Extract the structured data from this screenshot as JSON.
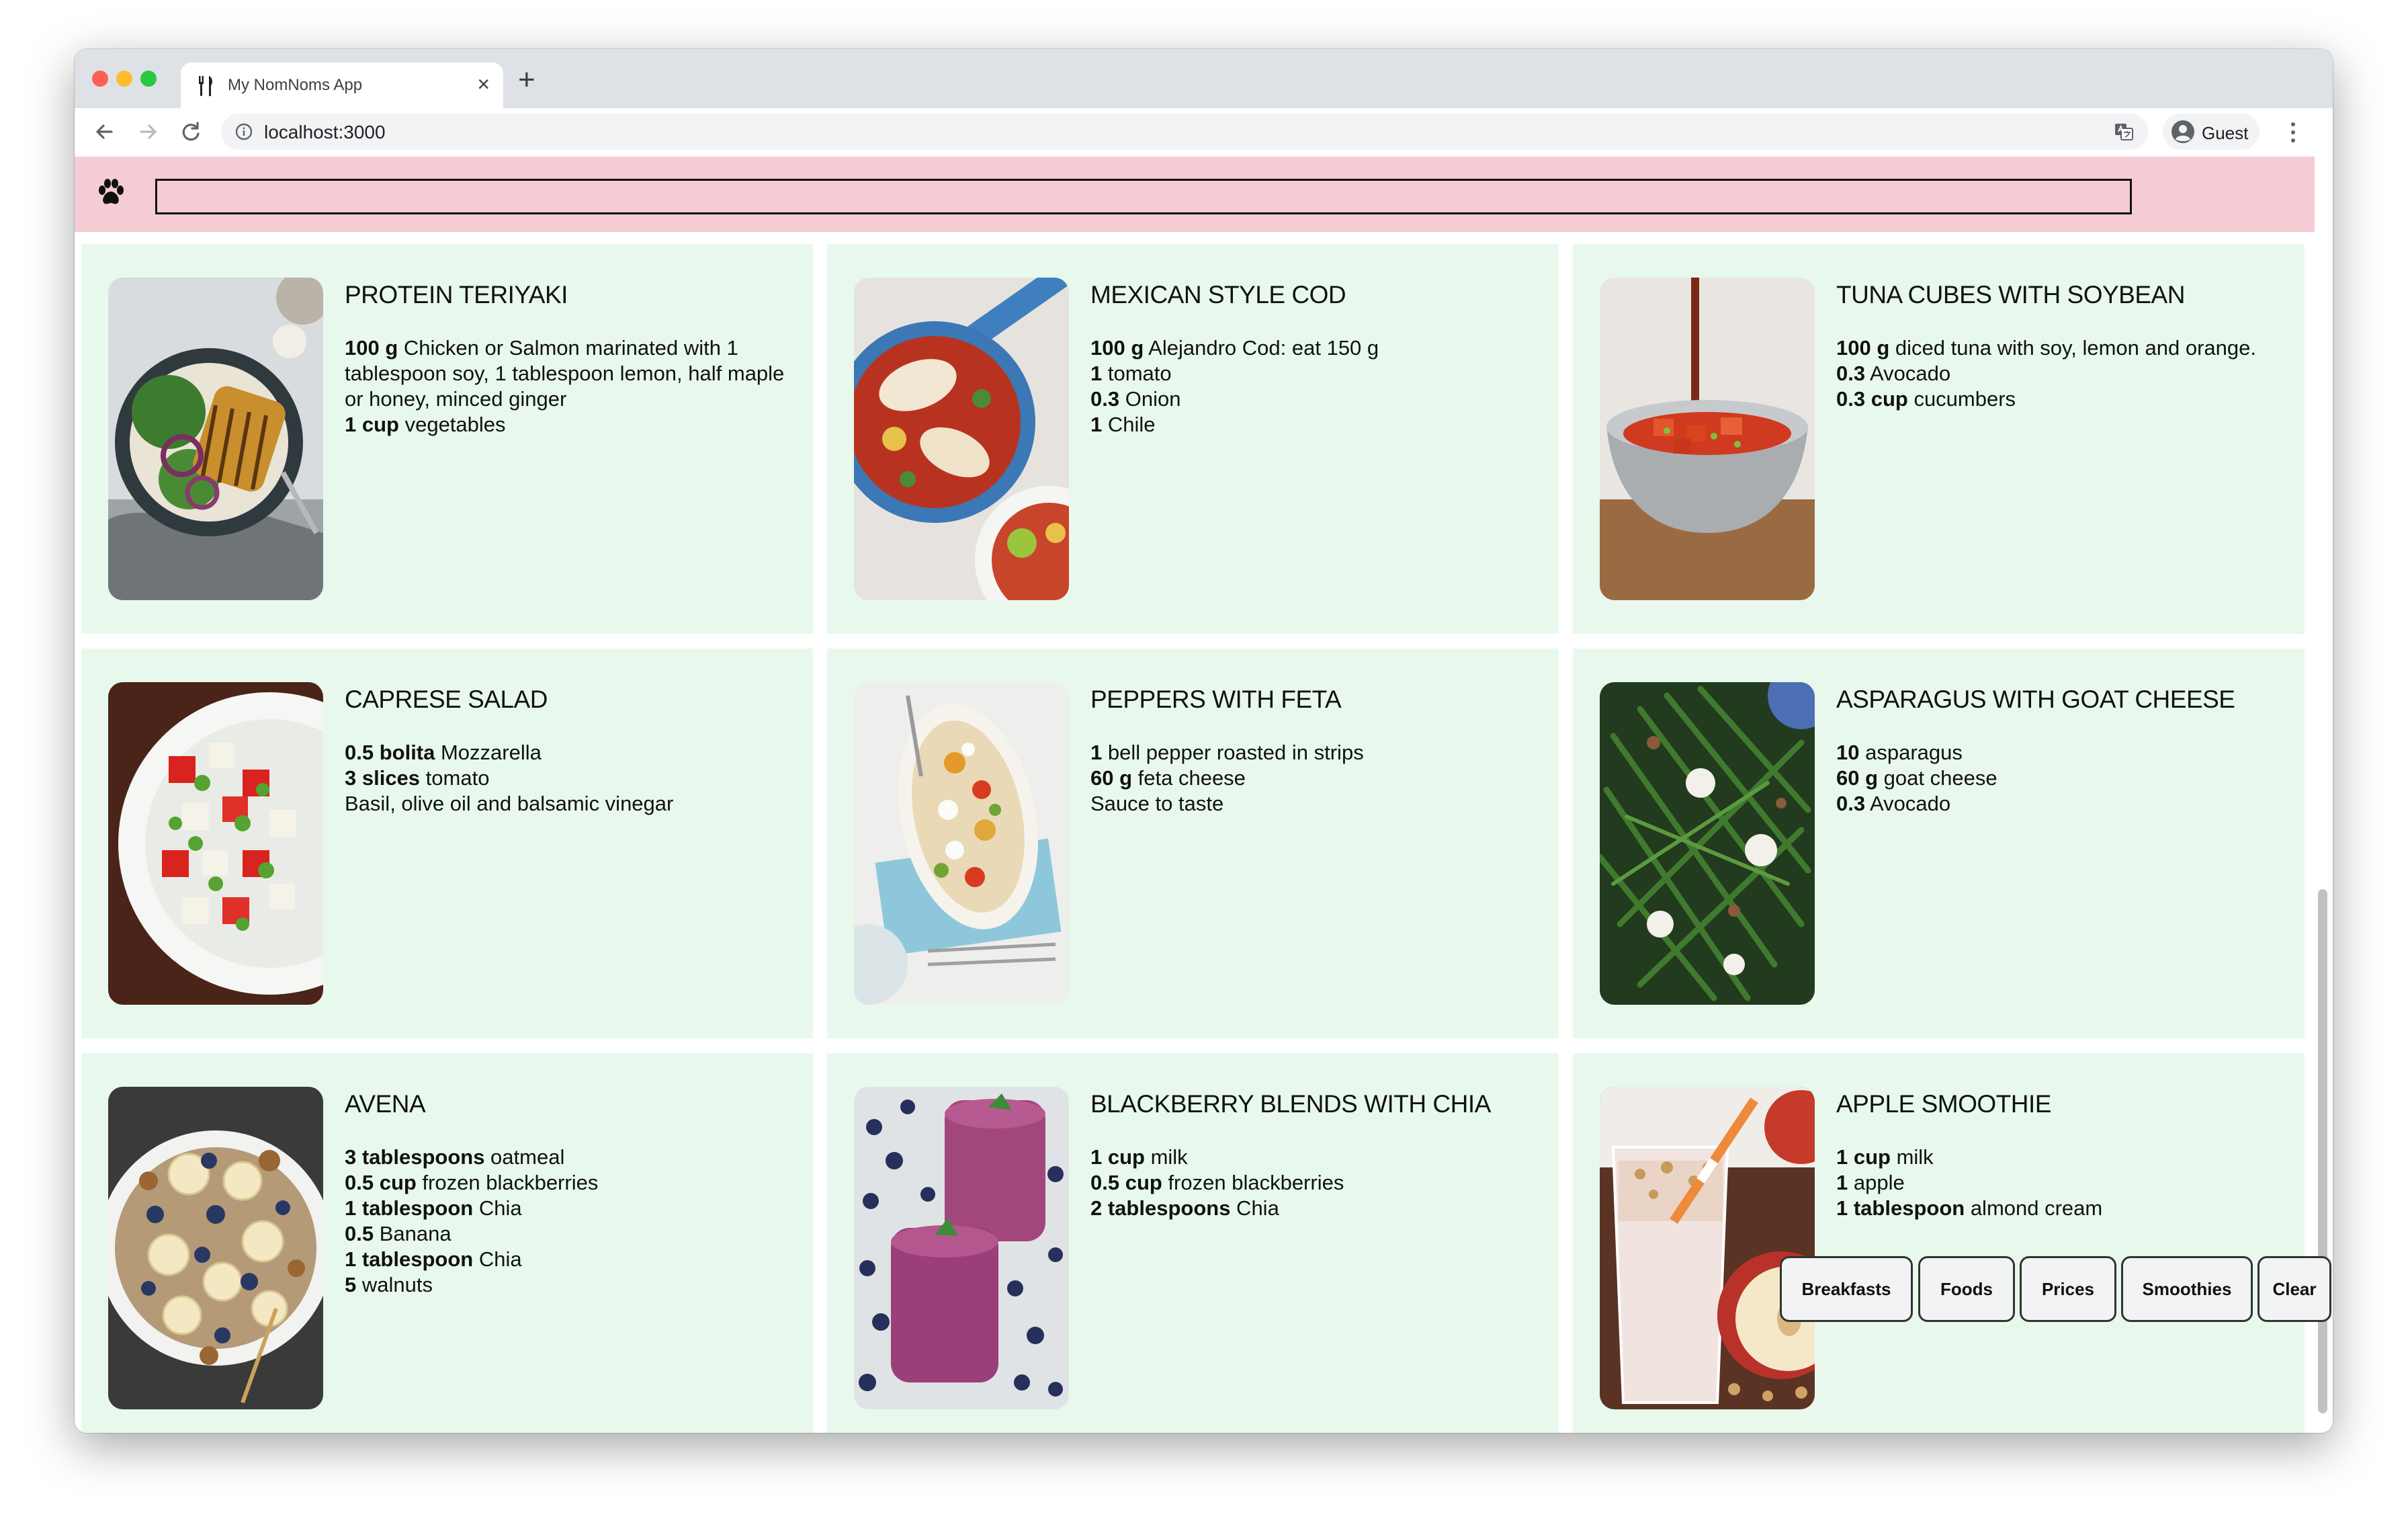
{
  "browser": {
    "tab_title": "My NomNoms App",
    "url": "localhost:3000",
    "profile_label": "Guest"
  },
  "search": {
    "value": ""
  },
  "recipes": [
    {
      "title": "PROTEIN TERIYAKI",
      "image": "teriyaki-bowl",
      "ingredients": [
        {
          "qty": "100 g",
          "text": " Chicken or Salmon marinated with 1 tablespoon soy, 1 tablespoon lemon, half maple or honey, minced ginger"
        },
        {
          "qty": "1 cup",
          "text": " vegetables"
        }
      ]
    },
    {
      "title": "MEXICAN STYLE COD",
      "image": "cod-skillet",
      "ingredients": [
        {
          "qty": "100 g",
          "text": " Alejandro Cod: eat 150 g"
        },
        {
          "qty": "1",
          "text": " tomato"
        },
        {
          "qty": "0.3",
          "text": " Onion"
        },
        {
          "qty": "1",
          "text": " Chile"
        }
      ]
    },
    {
      "title": "TUNA CUBES WITH SOYBEAN",
      "image": "tuna-bowl",
      "ingredients": [
        {
          "qty": "100 g",
          "text": " diced tuna with soy, lemon and orange."
        },
        {
          "qty": "0.3",
          "text": " Avocado"
        },
        {
          "qty": "0.3 cup",
          "text": " cucumbers"
        }
      ]
    },
    {
      "title": "CAPRESE SALAD",
      "image": "caprese-plate",
      "ingredients": [
        {
          "qty": "0.5 bolita",
          "text": " Mozzarella"
        },
        {
          "qty": "3 slices",
          "text": " tomato"
        },
        {
          "qty": "",
          "text": "Basil, olive oil and balsamic vinegar"
        }
      ]
    },
    {
      "title": "PEPPERS WITH FETA",
      "image": "peppers-dish",
      "ingredients": [
        {
          "qty": "1",
          "text": " bell pepper roasted in strips"
        },
        {
          "qty": "60 g",
          "text": " feta cheese"
        },
        {
          "qty": "",
          "text": "Sauce to taste"
        }
      ]
    },
    {
      "title": "ASPARAGUS WITH GOAT CHEESE",
      "image": "asparagus-salad",
      "ingredients": [
        {
          "qty": "10",
          "text": " asparagus"
        },
        {
          "qty": "60 g",
          "text": " goat cheese"
        },
        {
          "qty": "0.3",
          "text": " Avocado"
        }
      ]
    },
    {
      "title": "AVENA",
      "image": "oatmeal-bowl",
      "ingredients": [
        {
          "qty": "3 tablespoons",
          "text": " oatmeal"
        },
        {
          "qty": "0.5 cup",
          "text": " frozen blackberries"
        },
        {
          "qty": "1 tablespoon",
          "text": " Chia"
        },
        {
          "qty": "0.5",
          "text": " Banana"
        },
        {
          "qty": "1 tablespoon",
          "text": " Chia"
        },
        {
          "qty": "5",
          "text": " walnuts"
        }
      ]
    },
    {
      "title": "BLACKBERRY BLENDS WITH CHIA",
      "image": "berry-smoothie",
      "ingredients": [
        {
          "qty": "1 cup",
          "text": " milk"
        },
        {
          "qty": "0.5 cup",
          "text": " frozen blackberries"
        },
        {
          "qty": "2 tablespoons",
          "text": " Chia"
        }
      ]
    },
    {
      "title": "APPLE SMOOTHIE",
      "image": "apple-smoothie",
      "ingredients": [
        {
          "qty": "1 cup",
          "text": " milk"
        },
        {
          "qty": "1",
          "text": " apple"
        },
        {
          "qty": "1 tablespoon",
          "text": " almond cream"
        }
      ]
    }
  ],
  "filters": [
    "Breakfasts",
    "Foods",
    "Prices",
    "Smoothies",
    "Clear"
  ],
  "colors": {
    "header": "#f5ccd3",
    "card": "#e8f8ed"
  }
}
